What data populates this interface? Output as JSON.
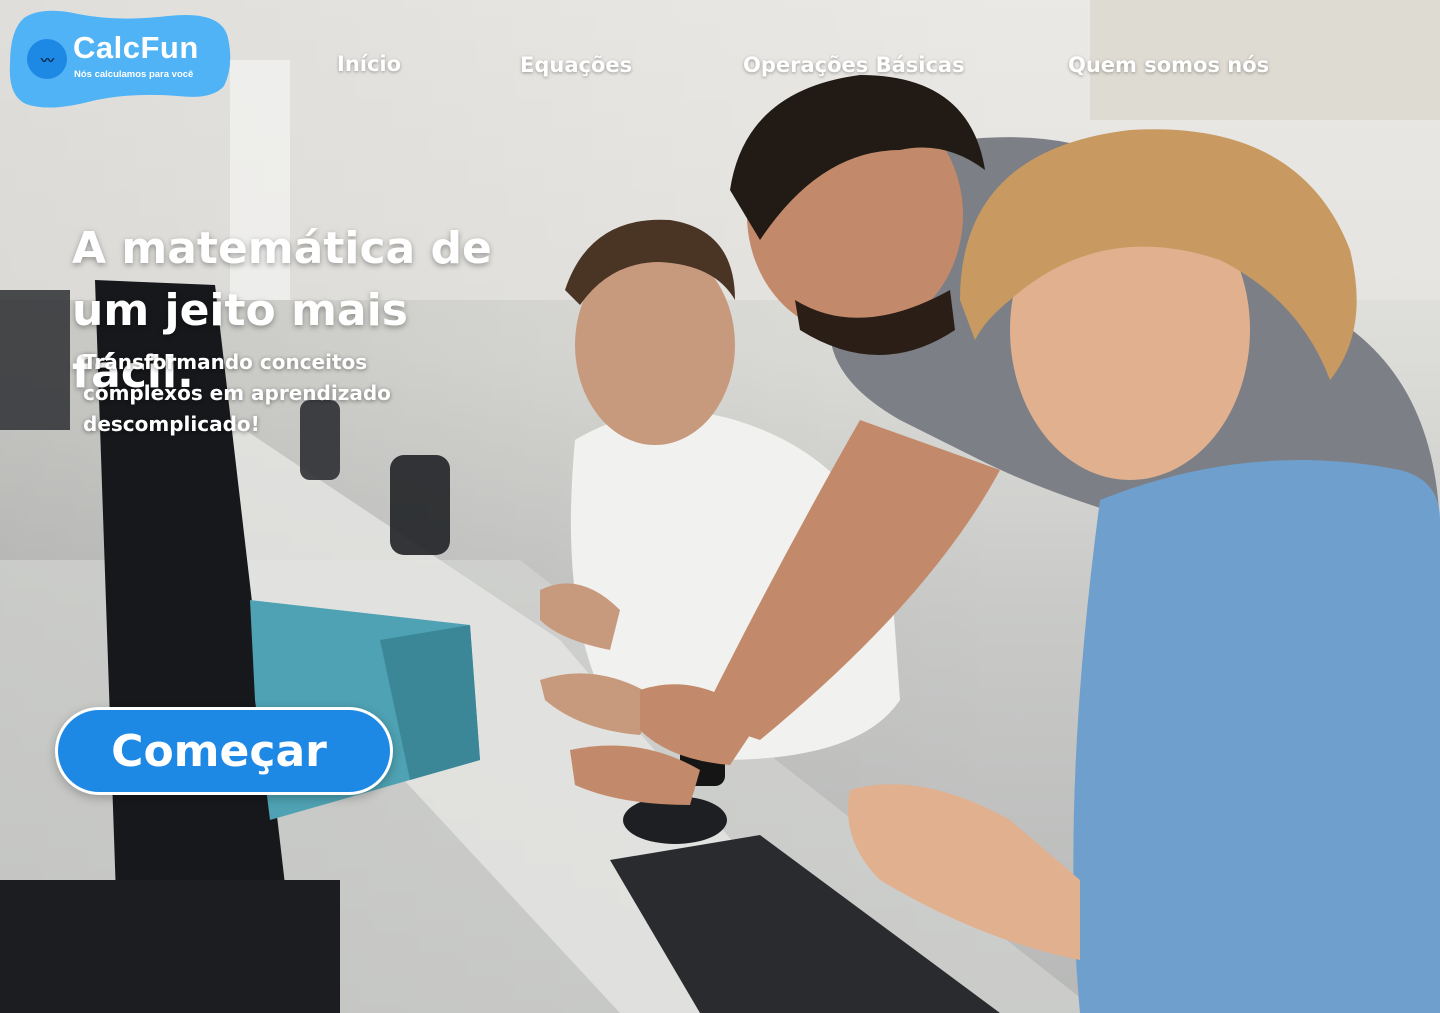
{
  "brand": {
    "name": "CalcFun",
    "tagline": "Nós calculamos para você",
    "mark_glyph": "〰",
    "icon": "calcfun-logo-icon",
    "colors": {
      "primary": "#1e88e5",
      "logo_bg": "#4fb3f6",
      "text_on_primary": "#ffffff"
    }
  },
  "nav": {
    "items": [
      {
        "label": "Início"
      },
      {
        "label": "Equações"
      },
      {
        "label": "Operações Básicas"
      },
      {
        "label": "Quem somos nós"
      }
    ]
  },
  "hero": {
    "title": "A matemática de um jeito mais fácil.",
    "subtitle": "Transformando conceitos complexos em aprendizado descomplicado!",
    "cta_label": "Começar"
  }
}
